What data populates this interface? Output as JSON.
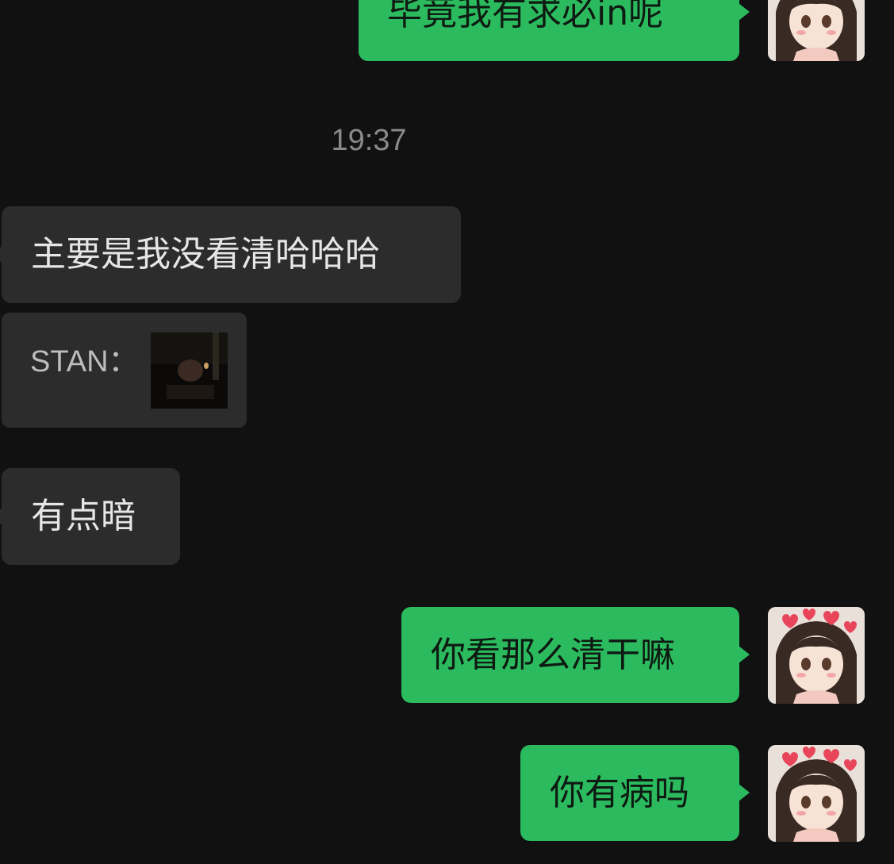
{
  "messages": [
    {
      "direction": "out",
      "text": "毕竟我有求必in呢"
    },
    {
      "direction": "in",
      "text": "主要是我没看清哈哈哈"
    },
    {
      "direction": "in",
      "text": "有点暗"
    },
    {
      "direction": "out",
      "text": "你看那么清干嘛"
    },
    {
      "direction": "out",
      "text": "你有病吗"
    }
  ],
  "timestamp": "19:37",
  "quote": {
    "label": "STAN：",
    "attachment": "photo-thumbnail"
  },
  "colors": {
    "background": "#111111",
    "outgoing_bubble": "#2BBB5E",
    "incoming_bubble": "#2C2C2C",
    "timestamp": "#8A8A8A"
  }
}
